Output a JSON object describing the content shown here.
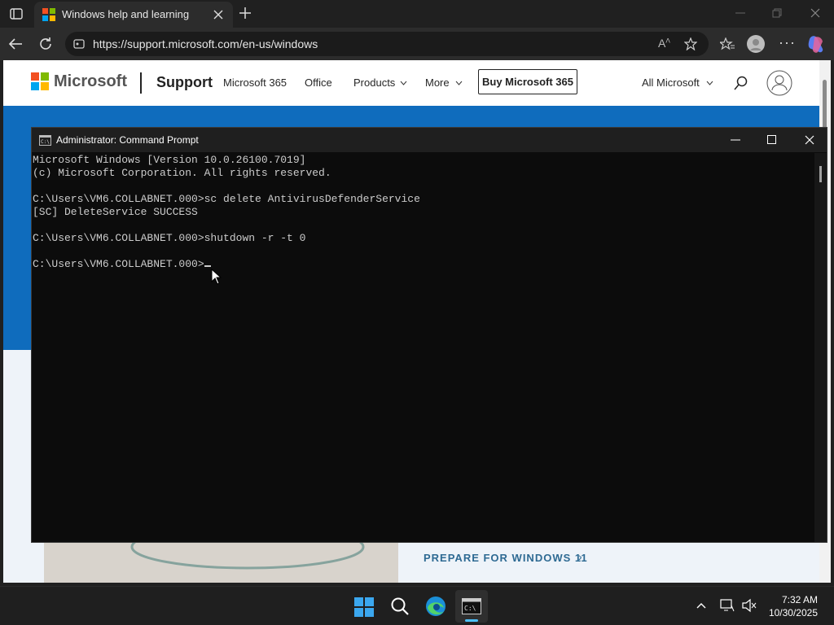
{
  "browser": {
    "tab_title": "Windows help and learning",
    "url": "https://support.microsoft.com/en-us/windows"
  },
  "site": {
    "brand": "Microsoft",
    "section": "Support",
    "nav": [
      "Microsoft 365",
      "Office",
      "Products",
      "More"
    ],
    "buy_button": "Buy Microsoft 365",
    "all_microsoft": "All Microsoft",
    "prepare_link": "PREPARE FOR WINDOWS 11"
  },
  "cmd": {
    "title": "Administrator: Command Prompt",
    "lines": [
      "Microsoft Windows [Version 10.0.26100.7019]",
      "(c) Microsoft Corporation. All rights reserved.",
      "",
      "C:\\Users\\VM6.COLLABNET.000>sc delete AntivirusDefenderService",
      "[SC] DeleteService SUCCESS",
      "",
      "C:\\Users\\VM6.COLLABNET.000>shutdown -r -t 0",
      ""
    ],
    "prompt": "C:\\Users\\VM6.COLLABNET.000>"
  },
  "taskbar": {
    "time": "7:32 AM",
    "date": "10/30/2025"
  },
  "colors": {
    "hero": "#0f6cbd",
    "cmd_bg": "#0c0c0c",
    "taskbar": "#1f1f1f"
  }
}
